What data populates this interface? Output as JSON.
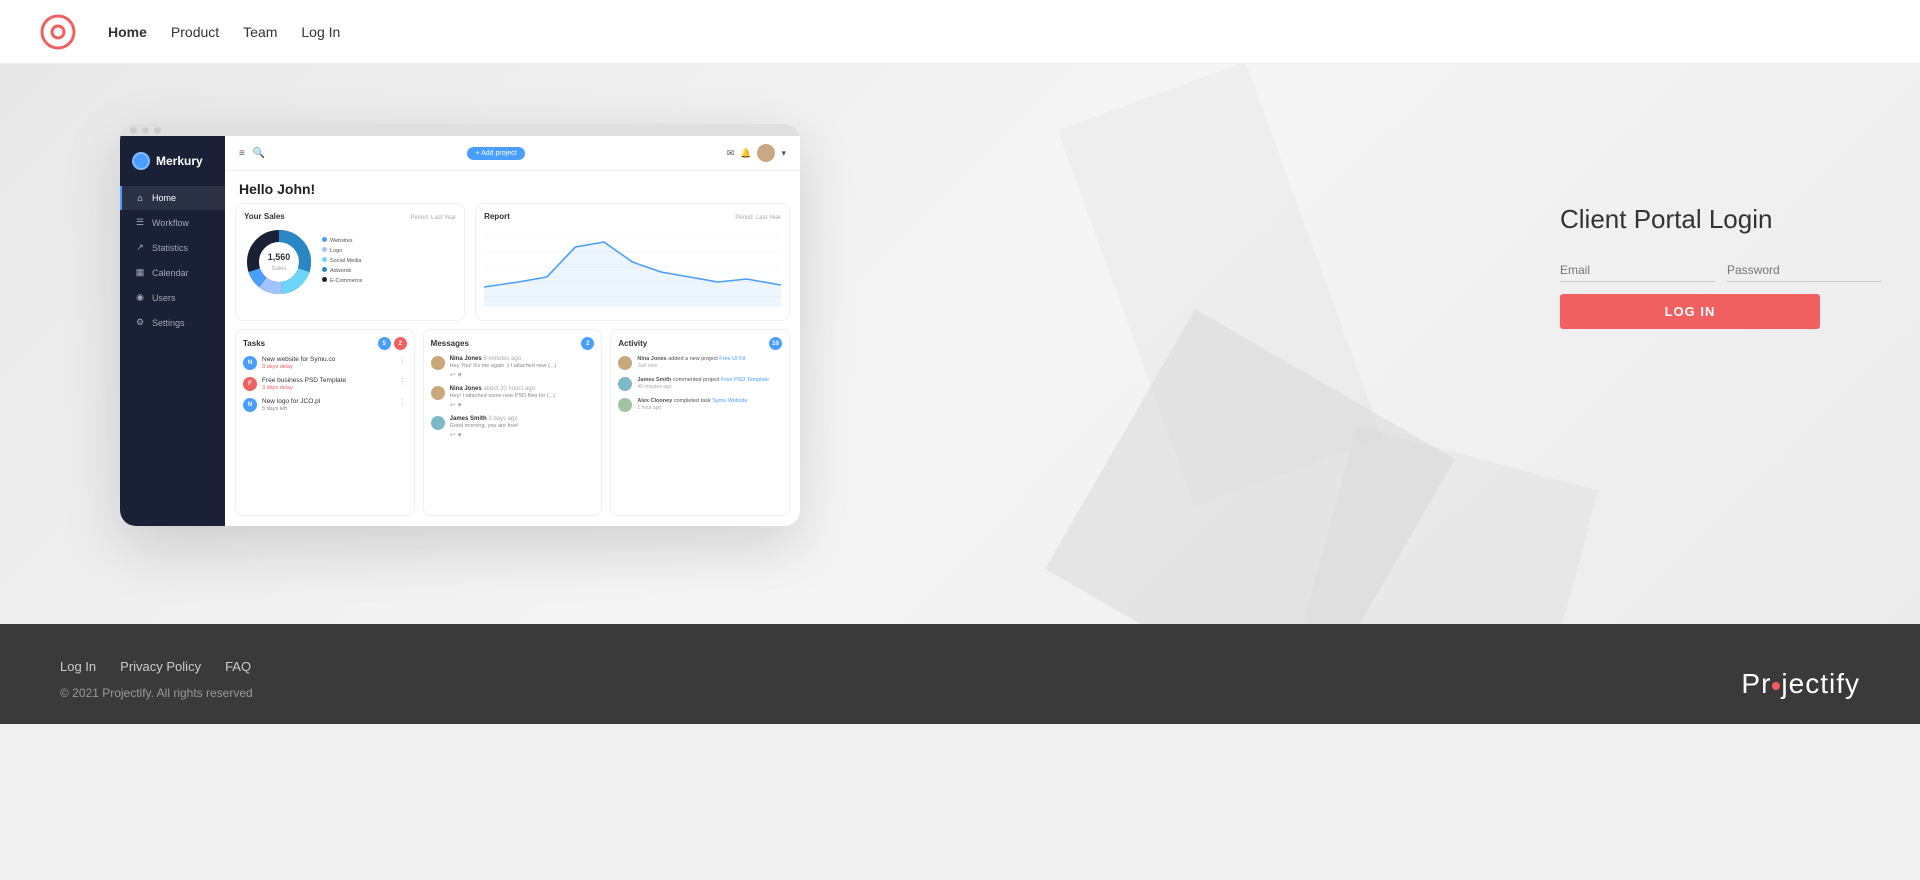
{
  "navbar": {
    "logo_text": "O",
    "links": [
      {
        "label": "Home",
        "active": true
      },
      {
        "label": "Product",
        "active": false
      },
      {
        "label": "Team",
        "active": false
      },
      {
        "label": "Log In",
        "active": false
      }
    ]
  },
  "dashboard": {
    "brand": "Merkury",
    "add_project": "+ Add project",
    "greeting": "Hello John!",
    "sidebar_items": [
      {
        "icon": "⌂",
        "label": "Home",
        "active": true
      },
      {
        "icon": "☰",
        "label": "Workflow",
        "active": false
      },
      {
        "icon": "↗",
        "label": "Statistics",
        "active": false
      },
      {
        "icon": "📅",
        "label": "Calendar",
        "active": false
      },
      {
        "icon": "👤",
        "label": "Users",
        "active": false
      },
      {
        "icon": "⚙",
        "label": "Settings",
        "active": false
      }
    ],
    "sales": {
      "title": "Your Sales",
      "period": "Period: Last Year",
      "center_value": "1,560",
      "center_label": "Sales",
      "legend": [
        {
          "color": "#4a9eff",
          "label": "Websites"
        },
        {
          "color": "#a0c4ff",
          "label": "Logo"
        },
        {
          "color": "#6dd5fa",
          "label": "Social Media"
        },
        {
          "color": "#2b86c5",
          "label": "Adwords"
        },
        {
          "color": "#1a2035",
          "label": "E-Commerce"
        }
      ]
    },
    "report": {
      "title": "Report",
      "period": "Period: Last Year"
    },
    "tasks": {
      "title": "Tasks",
      "badge1": "5",
      "badge2": "2",
      "items": [
        {
          "initial": "N",
          "color": "#4a9eff",
          "name": "New website for Symu.co",
          "date": "3 days delay"
        },
        {
          "initial": "F",
          "color": "#f06060",
          "name": "Free business PSD Template",
          "date": "3 days delay"
        },
        {
          "initial": "N",
          "color": "#4a9eff",
          "name": "New logo for JCO.pl",
          "date": "5 days left"
        }
      ]
    },
    "messages": {
      "title": "Messages",
      "badge": "2",
      "items": [
        {
          "name": "Nina Jones",
          "time": "8 minutes ago",
          "text": "Hey You! It's me again :) I attached new (...)"
        },
        {
          "name": "Nina Jones",
          "time": "about 20 hours ago",
          "text": "Hey! I attached some new PSD files for (...)"
        },
        {
          "name": "James Smith",
          "time": "3 days ago",
          "text": "Good morning, you are free!"
        }
      ]
    },
    "activity": {
      "title": "Activity",
      "badge": "10",
      "items": [
        {
          "name": "Nina Jones",
          "action": "added a new project",
          "project": "Free UI Kit",
          "time": "Just now"
        },
        {
          "name": "James Smith",
          "action": "commented project",
          "project": "Free PSD Template",
          "time": "40 minutes ago"
        },
        {
          "name": "Alex Clooney",
          "action": "completed task",
          "project": "Symu Website",
          "time": "1 hour ago"
        }
      ]
    }
  },
  "login": {
    "title": "Client Portal Login",
    "email_placeholder": "Email",
    "password_placeholder": "Password",
    "button_label": "LOG IN"
  },
  "footer": {
    "links": [
      "Log In",
      "Privacy Policy",
      "FAQ"
    ],
    "copyright": "© 2021 Projectify. All rights reserved",
    "brand": "Projectify"
  }
}
